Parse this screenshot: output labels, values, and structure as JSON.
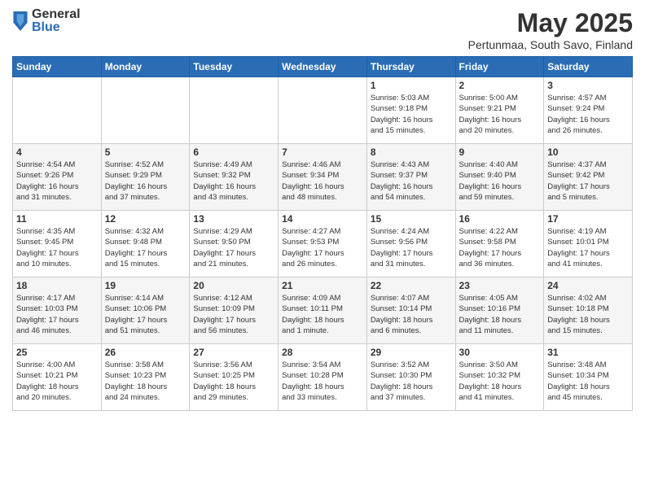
{
  "header": {
    "logo_general": "General",
    "logo_blue": "Blue",
    "month_title": "May 2025",
    "subtitle": "Pertunmaa, South Savo, Finland"
  },
  "weekdays": [
    "Sunday",
    "Monday",
    "Tuesday",
    "Wednesday",
    "Thursday",
    "Friday",
    "Saturday"
  ],
  "weeks": [
    [
      {
        "day": "",
        "info": ""
      },
      {
        "day": "",
        "info": ""
      },
      {
        "day": "",
        "info": ""
      },
      {
        "day": "",
        "info": ""
      },
      {
        "day": "1",
        "info": "Sunrise: 5:03 AM\nSunset: 9:18 PM\nDaylight: 16 hours\nand 15 minutes."
      },
      {
        "day": "2",
        "info": "Sunrise: 5:00 AM\nSunset: 9:21 PM\nDaylight: 16 hours\nand 20 minutes."
      },
      {
        "day": "3",
        "info": "Sunrise: 4:57 AM\nSunset: 9:24 PM\nDaylight: 16 hours\nand 26 minutes."
      }
    ],
    [
      {
        "day": "4",
        "info": "Sunrise: 4:54 AM\nSunset: 9:26 PM\nDaylight: 16 hours\nand 31 minutes."
      },
      {
        "day": "5",
        "info": "Sunrise: 4:52 AM\nSunset: 9:29 PM\nDaylight: 16 hours\nand 37 minutes."
      },
      {
        "day": "6",
        "info": "Sunrise: 4:49 AM\nSunset: 9:32 PM\nDaylight: 16 hours\nand 43 minutes."
      },
      {
        "day": "7",
        "info": "Sunrise: 4:46 AM\nSunset: 9:34 PM\nDaylight: 16 hours\nand 48 minutes."
      },
      {
        "day": "8",
        "info": "Sunrise: 4:43 AM\nSunset: 9:37 PM\nDaylight: 16 hours\nand 54 minutes."
      },
      {
        "day": "9",
        "info": "Sunrise: 4:40 AM\nSunset: 9:40 PM\nDaylight: 16 hours\nand 59 minutes."
      },
      {
        "day": "10",
        "info": "Sunrise: 4:37 AM\nSunset: 9:42 PM\nDaylight: 17 hours\nand 5 minutes."
      }
    ],
    [
      {
        "day": "11",
        "info": "Sunrise: 4:35 AM\nSunset: 9:45 PM\nDaylight: 17 hours\nand 10 minutes."
      },
      {
        "day": "12",
        "info": "Sunrise: 4:32 AM\nSunset: 9:48 PM\nDaylight: 17 hours\nand 15 minutes."
      },
      {
        "day": "13",
        "info": "Sunrise: 4:29 AM\nSunset: 9:50 PM\nDaylight: 17 hours\nand 21 minutes."
      },
      {
        "day": "14",
        "info": "Sunrise: 4:27 AM\nSunset: 9:53 PM\nDaylight: 17 hours\nand 26 minutes."
      },
      {
        "day": "15",
        "info": "Sunrise: 4:24 AM\nSunset: 9:56 PM\nDaylight: 17 hours\nand 31 minutes."
      },
      {
        "day": "16",
        "info": "Sunrise: 4:22 AM\nSunset: 9:58 PM\nDaylight: 17 hours\nand 36 minutes."
      },
      {
        "day": "17",
        "info": "Sunrise: 4:19 AM\nSunset: 10:01 PM\nDaylight: 17 hours\nand 41 minutes."
      }
    ],
    [
      {
        "day": "18",
        "info": "Sunrise: 4:17 AM\nSunset: 10:03 PM\nDaylight: 17 hours\nand 46 minutes."
      },
      {
        "day": "19",
        "info": "Sunrise: 4:14 AM\nSunset: 10:06 PM\nDaylight: 17 hours\nand 51 minutes."
      },
      {
        "day": "20",
        "info": "Sunrise: 4:12 AM\nSunset: 10:09 PM\nDaylight: 17 hours\nand 56 minutes."
      },
      {
        "day": "21",
        "info": "Sunrise: 4:09 AM\nSunset: 10:11 PM\nDaylight: 18 hours\nand 1 minute."
      },
      {
        "day": "22",
        "info": "Sunrise: 4:07 AM\nSunset: 10:14 PM\nDaylight: 18 hours\nand 6 minutes."
      },
      {
        "day": "23",
        "info": "Sunrise: 4:05 AM\nSunset: 10:16 PM\nDaylight: 18 hours\nand 11 minutes."
      },
      {
        "day": "24",
        "info": "Sunrise: 4:02 AM\nSunset: 10:18 PM\nDaylight: 18 hours\nand 15 minutes."
      }
    ],
    [
      {
        "day": "25",
        "info": "Sunrise: 4:00 AM\nSunset: 10:21 PM\nDaylight: 18 hours\nand 20 minutes."
      },
      {
        "day": "26",
        "info": "Sunrise: 3:58 AM\nSunset: 10:23 PM\nDaylight: 18 hours\nand 24 minutes."
      },
      {
        "day": "27",
        "info": "Sunrise: 3:56 AM\nSunset: 10:25 PM\nDaylight: 18 hours\nand 29 minutes."
      },
      {
        "day": "28",
        "info": "Sunrise: 3:54 AM\nSunset: 10:28 PM\nDaylight: 18 hours\nand 33 minutes."
      },
      {
        "day": "29",
        "info": "Sunrise: 3:52 AM\nSunset: 10:30 PM\nDaylight: 18 hours\nand 37 minutes."
      },
      {
        "day": "30",
        "info": "Sunrise: 3:50 AM\nSunset: 10:32 PM\nDaylight: 18 hours\nand 41 minutes."
      },
      {
        "day": "31",
        "info": "Sunrise: 3:48 AM\nSunset: 10:34 PM\nDaylight: 18 hours\nand 45 minutes."
      }
    ]
  ]
}
